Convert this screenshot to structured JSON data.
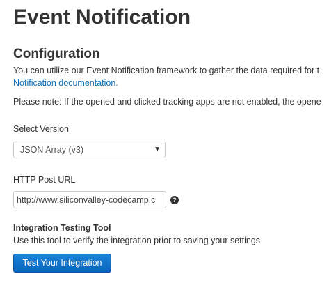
{
  "page": {
    "title": "Event Notification"
  },
  "configuration": {
    "heading": "Configuration",
    "intro_text": "You can utilize our Event Notification framework to gather the data required for t",
    "doc_link": "Notification documentation.",
    "note_text": "Please note: If the opened and clicked tracking apps are not enabled, the opene"
  },
  "version": {
    "label": "Select Version",
    "selected": "JSON Array (v3)",
    "arrow_icon": "dropdown-arrow-icon"
  },
  "post_url": {
    "label": "HTTP Post URL",
    "value": "http://www.siliconvalley-codecamp.c",
    "help_icon": "question-mark-icon",
    "help_glyph": "?"
  },
  "testing_tool": {
    "heading": "Integration Testing Tool",
    "description": "Use this tool to verify the integration prior to saving your settings",
    "button_label": "Test Your Integration"
  },
  "colors": {
    "text": "#333333",
    "link": "#0e6fb8",
    "button": "#0a63bd",
    "border": "#c9c9c9"
  }
}
